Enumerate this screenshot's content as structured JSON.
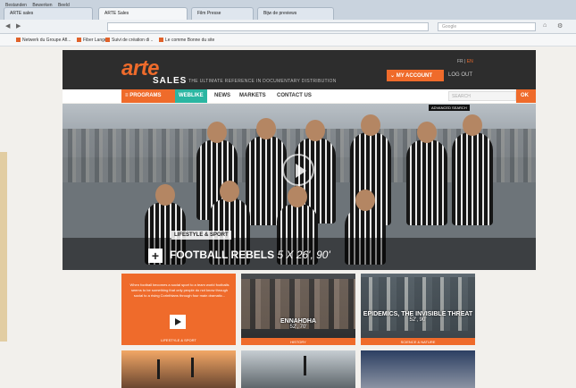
{
  "browser": {
    "menu": [
      "Bestanden",
      "Bewerken",
      "Beeld",
      "Geschiedenis",
      "Bladwijzers",
      "Extra",
      "Help"
    ],
    "tabs": [
      "ARTE sales",
      "ARTE Sales",
      "Film Presse",
      "Bijw de previews"
    ],
    "search_placeholder": "Google",
    "bookmarks": [
      "Netwerk du Groupe Afl...",
      "Fiber Lange",
      "Suivi de création di ..",
      "Le comme Bonne du site"
    ]
  },
  "header": {
    "logo": "arte",
    "logo_sub": "SALES",
    "tagline": "THE ULTIMATE REFERENCE IN DOCUMENTARY DISTRIBUTION",
    "lang_fr": "FR",
    "lang_en": "EN",
    "my_account": "MY ACCOUNT",
    "logout": "LOG OUT"
  },
  "nav": {
    "items": [
      "PROGRAMS",
      "WEBLIKE",
      "NEWS",
      "MARKETS",
      "CONTACT US"
    ],
    "search_placeholder": "SEARCH",
    "ok": "OK",
    "advanced": "ADVANCED SEARCH"
  },
  "hero": {
    "category": "LIFESTYLE & SPORT",
    "title": "FOOTBALL REBELS",
    "duration": "5 X 26', 90'"
  },
  "tiles": [
    {
      "text": "When football becomes a social sport to a team world footballs seems to be something that only people do not know through social to a rising Corinthians through four main dramatic...",
      "tag": "LIFESTYLE & SPORT"
    },
    {
      "title": "ENNAHDHA",
      "sub": "52', 70'",
      "bar": "HISTORY"
    },
    {
      "title": "EPIDEMICS, THE INVISIBLE THREAT",
      "sub": "52', 90'",
      "bar": "SCIENCE & NATURE"
    }
  ],
  "colors": {
    "accent": "#ef6b2b",
    "teal": "#2bb6a2",
    "header_bg": "#2d2d2d"
  }
}
